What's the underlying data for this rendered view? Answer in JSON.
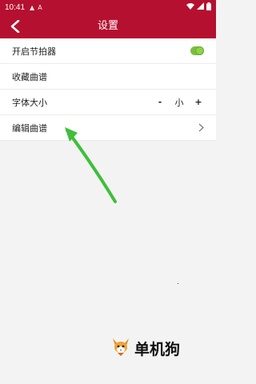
{
  "status_bar": {
    "time": "10:41",
    "icons": [
      "notification-icon",
      "text-icon",
      "wifi-icon",
      "cell-signal-icon",
      "battery-icon"
    ]
  },
  "header": {
    "title": "设置",
    "back_icon": "back-arrow-icon"
  },
  "settings": {
    "metronome": {
      "label": "开启节拍器",
      "enabled": true
    },
    "favorites": {
      "label": "收藏曲谱"
    },
    "font_size": {
      "label": "字体大小",
      "minus": "-",
      "value": "小",
      "plus": "+"
    },
    "edit_score": {
      "label": "编辑曲谱",
      "icon": "chevron-right-icon"
    }
  },
  "watermark": {
    "text": "单机狗"
  },
  "colors": {
    "brand": "#b5102f",
    "toggle_on": "#7bbf3e",
    "annotation_arrow": "#3fbf3a",
    "background": "#f3f3f3"
  }
}
